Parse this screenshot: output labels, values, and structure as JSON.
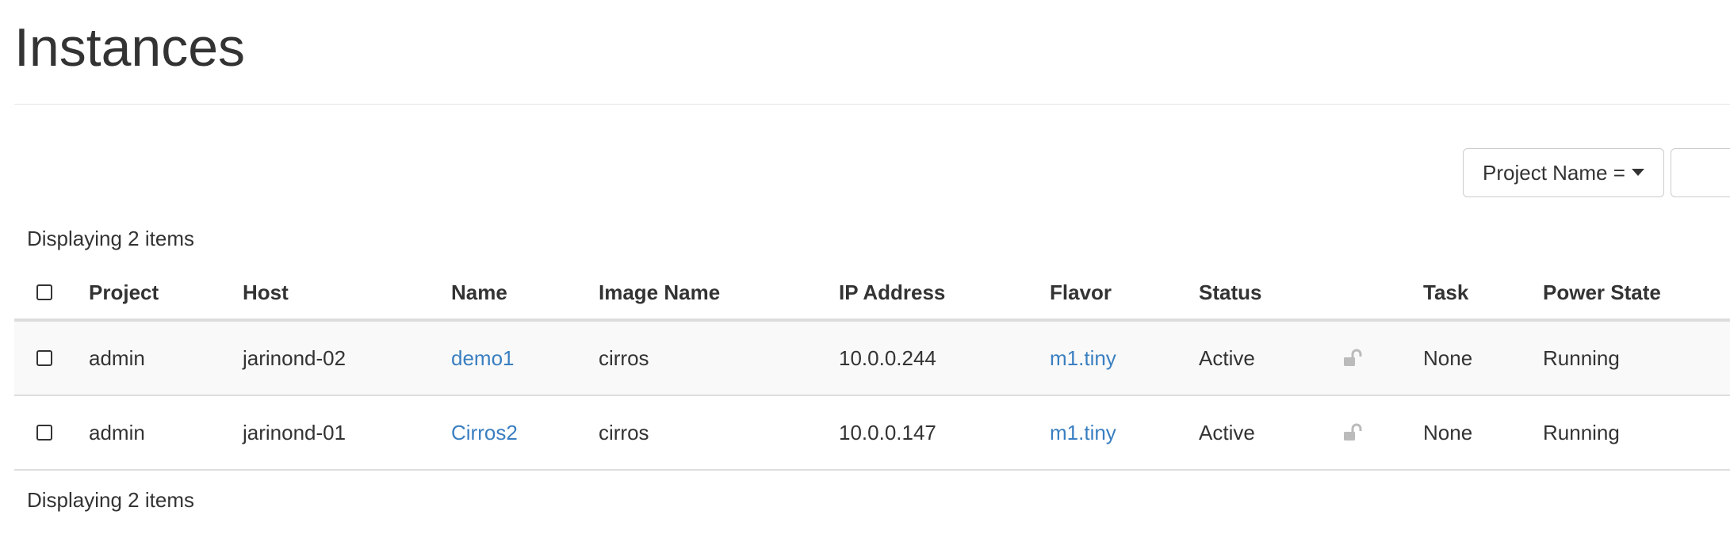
{
  "page": {
    "title": "Instances"
  },
  "filter": {
    "field_label": "Project Name ="
  },
  "summary": {
    "top": "Displaying 2 items",
    "bottom": "Displaying 2 items"
  },
  "table": {
    "headers": {
      "project": "Project",
      "host": "Host",
      "name": "Name",
      "image_name": "Image Name",
      "ip_address": "IP Address",
      "flavor": "Flavor",
      "status": "Status",
      "task": "Task",
      "power_state": "Power State"
    },
    "rows": [
      {
        "project": "admin",
        "host": "jarinond-02",
        "name": "demo1",
        "image_name": "cirros",
        "ip_address": "10.0.0.244",
        "flavor": "m1.tiny",
        "status": "Active",
        "lock_icon": "unlocked-padlock",
        "task": "None",
        "power_state": "Running"
      },
      {
        "project": "admin",
        "host": "jarinond-01",
        "name": "Cirros2",
        "image_name": "cirros",
        "ip_address": "10.0.0.147",
        "flavor": "m1.tiny",
        "status": "Active",
        "lock_icon": "unlocked-padlock",
        "task": "None",
        "power_state": "Running"
      }
    ]
  },
  "colors": {
    "link": "#3a7fc1",
    "text": "#333333",
    "border": "#dddddd",
    "stripe": "#f9f9f9",
    "icon": "#bbbbbb"
  }
}
